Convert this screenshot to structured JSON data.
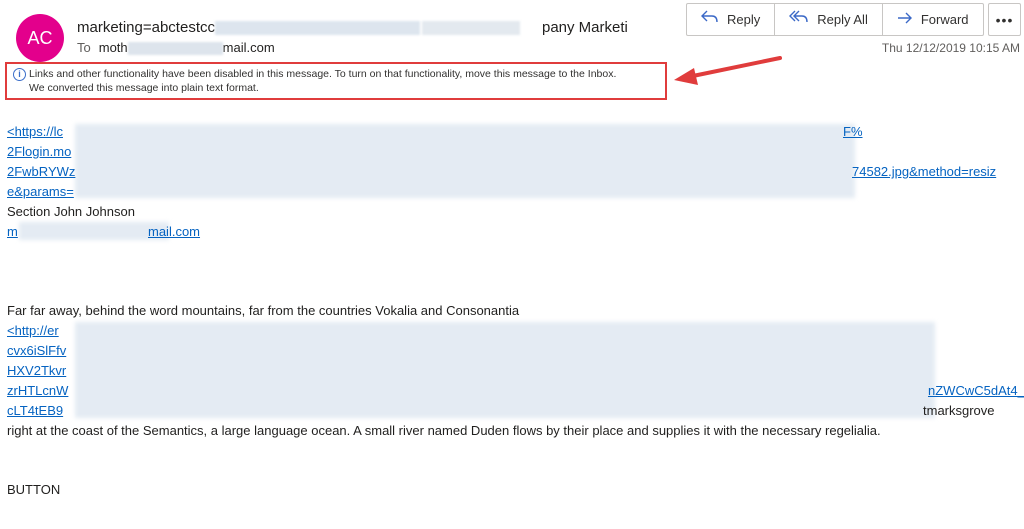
{
  "header": {
    "avatar_initials": "AC",
    "from_start": "marketing=abctestcc",
    "from_end": "pany Marketi",
    "to_label": "To",
    "to_start": "moth",
    "to_end": "mail.com",
    "date": "Thu 12/12/2019 10:15 AM"
  },
  "actions": {
    "reply": "Reply",
    "reply_all": "Reply All",
    "forward": "Forward",
    "more": "•••"
  },
  "infobar": {
    "line1": "Links and other functionality have been disabled in this message. To turn on that functionality, move this message to the Inbox.",
    "line2": "We converted this message into plain text format."
  },
  "body": {
    "link1_a": "<https://lc",
    "link1_a_end": "F%",
    "link1_b": "2Flogin.mo",
    "link1_c": "2FwbRYWz",
    "link1_c_end": "74582.jpg&method=resiz",
    "link1_d": "e&params=",
    "name": "Section John Johnson",
    "email_start": "m",
    "email_end": "mail.com",
    "para1": "Far far away, behind the word mountains, far from the countries Vokalia and Consonantia",
    "link2_a": "<http://er",
    "link2_b": "cvx6iSlFfv",
    "link2_c": "HXV2Tkvr",
    "link2_d": "zrHTLcnW",
    "link2_d_end": "nZWCwC5dAt4_",
    "link2_e": "cLT4tEB9",
    "link2_e_end": "tmarksgrove",
    "para2": "right at the coast of the Semantics, a large language ocean. A small river named Duden flows by their place and supplies it with the necessary regelialia.",
    "button_text": "BUTTON"
  },
  "colors": {
    "avatar": "#e3008c",
    "link": "#0563c1",
    "highlight_border": "#e03c3c",
    "icon_blue": "#3b69c7"
  }
}
